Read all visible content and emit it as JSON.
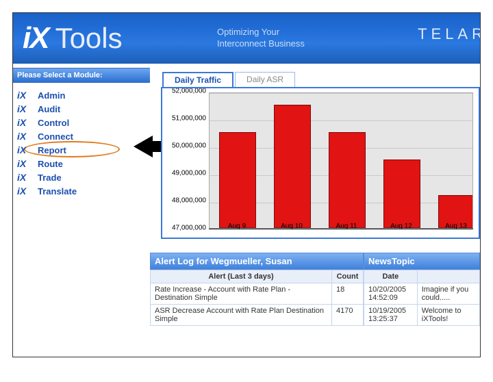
{
  "banner": {
    "logo_prefix": "iX",
    "logo_word": "Tools",
    "tagline_line1": "Optimizing Your",
    "tagline_line2": "Interconnect Business",
    "brand_right": "TELAR"
  },
  "sidebar": {
    "title": "Please Select a Module:",
    "items": [
      {
        "label": "Admin"
      },
      {
        "label": "Audit"
      },
      {
        "label": "Control"
      },
      {
        "label": "Connect"
      },
      {
        "label": "Report"
      },
      {
        "label": "Route"
      },
      {
        "label": "Trade"
      },
      {
        "label": "Translate"
      }
    ],
    "highlighted_index": 3
  },
  "tabs": {
    "active": "Daily Traffic",
    "inactive": "Daily ASR"
  },
  "chart_data": {
    "type": "bar",
    "categories": [
      "Aug 9",
      "Aug 10",
      "Aug 11",
      "Aug 12",
      "Aug 13"
    ],
    "values": [
      50500000,
      51500000,
      50500000,
      49500000,
      48200000
    ],
    "ylabel": "",
    "xlabel": "",
    "ylim": [
      47000000,
      52000000
    ],
    "yticks": [
      47000000,
      48000000,
      49000000,
      50000000,
      51000000,
      52000000
    ],
    "ytick_labels": [
      "47,000,000",
      "48,000,000",
      "49,000,000",
      "50,000,000",
      "51,000,000",
      "52,000,000"
    ]
  },
  "alert_panel": {
    "title": "Alert Log for Wegmueller, Susan",
    "col_alert": "Alert (Last 3 days)",
    "col_count": "Count",
    "rows": [
      {
        "alert": "Rate Increase - Account with Rate Plan - Destination Simple",
        "count": "18"
      },
      {
        "alert": "ASR Decrease Account with Rate Plan Destination Simple",
        "count": "4170"
      }
    ]
  },
  "news_panel": {
    "title": "NewsTopic",
    "col_date": "Date",
    "rows": [
      {
        "date": "10/20/2005 14:52:09",
        "topic": "Imagine if you could....."
      },
      {
        "date": "10/19/2005 13:25:37",
        "topic": "Welcome to iXTools!"
      }
    ]
  }
}
